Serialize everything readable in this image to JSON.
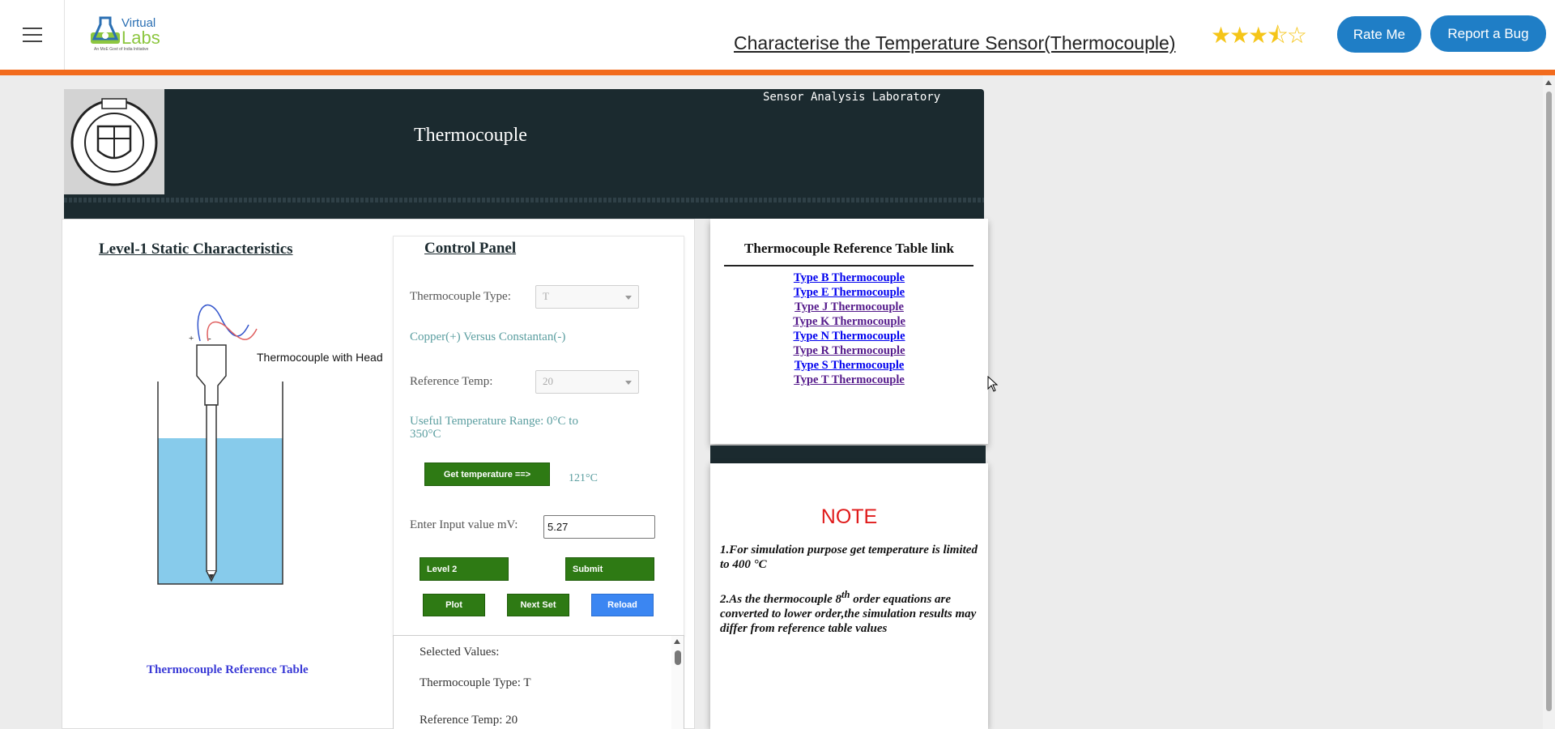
{
  "header": {
    "logo_text_top": "Virtual",
    "logo_text_bottom": "Labs",
    "logo_tagline": "An MoE Govt of India Initiative",
    "experiment_title": "Characterise the Temperature Sensor(Thermocouple)",
    "rating_stars": "★★★⯪☆",
    "rating_value": 3.5,
    "rate_button": "Rate Me",
    "bug_button": "Report a Bug"
  },
  "banner": {
    "lab_name": "Sensor Analysis Laboratory",
    "title": "Thermocouple"
  },
  "level": {
    "title": "Level-1 Static Characteristics",
    "diagram_caption": "Thermocouple with Head",
    "ref_table_link": "Thermocouple Reference Table"
  },
  "control_panel": {
    "title": "Control Panel",
    "thermocouple_type_label": "Thermocouple Type:",
    "thermocouple_type_value": "T",
    "material_text": "Copper(+) Versus Constantan(-)",
    "reference_temp_label": "Reference Temp:",
    "reference_temp_value": "20",
    "useful_range_text": "Useful Temperature Range: 0°C to 350°C",
    "get_temp_button": "Get temperature ==>",
    "temperature_value": "121°C",
    "input_label": "Enter Input value mV:",
    "input_value": "5.27",
    "level2_button": "Level 2",
    "submit_button": "Submit",
    "plot_button": "Plot",
    "next_set_button": "Next Set",
    "reload_button": "Reload"
  },
  "selected_values": {
    "title": "Selected Values:",
    "type_line": "Thermocouple Type: T",
    "ref_line": "Reference Temp: 20"
  },
  "reference_card": {
    "title": "Thermocouple Reference Table link",
    "links": [
      {
        "label": "Type B Thermocouple",
        "color": "#0000ee"
      },
      {
        "label": "Type E Thermocouple",
        "color": "#0000ee"
      },
      {
        "label": "Type J Thermocouple",
        "color": "#551a8b"
      },
      {
        "label": "Type K Thermocouple",
        "color": "#551a8b"
      },
      {
        "label": "Type N Thermocouple",
        "color": "#0000ee"
      },
      {
        "label": "Type R Thermocouple",
        "color": "#551a8b"
      },
      {
        "label": "Type S Thermocouple",
        "color": "#0000ee"
      },
      {
        "label": "Type T Thermocouple",
        "color": "#551a8b"
      }
    ]
  },
  "note": {
    "title": "NOTE",
    "point1": "1.For simulation purpose get temperature is limited to 400 °C",
    "point2_a": "2.As the thermocouple 8",
    "point2_sup": "th",
    "point2_b": " order equations are converted to lower order,the simulation results may differ from reference table values"
  },
  "colors": {
    "accent_orange": "#f26b1d",
    "banner_dark": "#1b2a2f",
    "button_blue": "#1f7ec6",
    "button_green": "#2e7a14",
    "note_red": "#e01b1b"
  }
}
